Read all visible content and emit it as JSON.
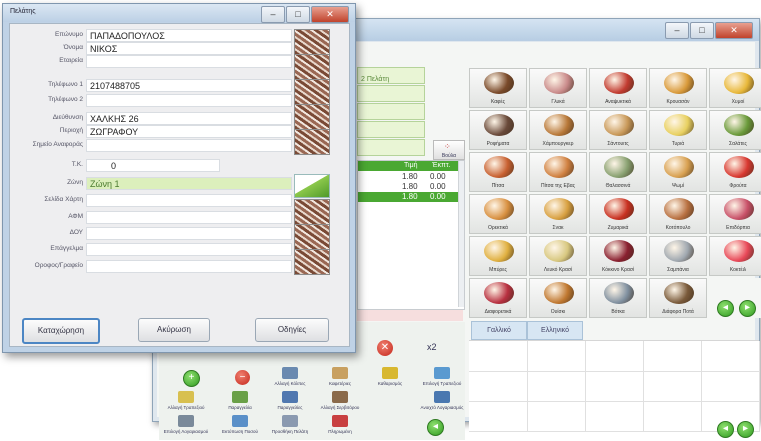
{
  "customer_dialog": {
    "title": "Πελάτης",
    "fields": [
      {
        "label": "Επώνυμο",
        "value": "ΠΑΠΑΔΟΠΟΥΛΟΣ"
      },
      {
        "label": "Όνομα",
        "value": "ΝΙΚΟΣ"
      },
      {
        "label": "Εταιρεία",
        "value": ""
      },
      {
        "label": "Τηλέφωνο 1",
        "value": "2107488705"
      },
      {
        "label": "Τηλέφωνο 2",
        "value": ""
      },
      {
        "label": "Διεύθυνση",
        "value": "ΧΑΛΚΗΣ 26"
      },
      {
        "label": "Περιοχή",
        "value": "ΖΩΓΡΑΦΟΥ"
      },
      {
        "label": "Σημείο Αναφοράς",
        "value": ""
      },
      {
        "label": "Τ.Κ.",
        "value": "0"
      },
      {
        "label": "Ζώνη",
        "value": "Ζώνη 1"
      },
      {
        "label": "Σελίδα Χάρτη",
        "value": ""
      },
      {
        "label": "ΑΦΜ",
        "value": ""
      },
      {
        "label": "ΔΟΥ",
        "value": ""
      },
      {
        "label": "Επάγγελμα",
        "value": ""
      },
      {
        "label": "Οροφος/Γραφείο",
        "value": ""
      }
    ],
    "buttons": {
      "register": "Καταχώρηση",
      "cancel": "Ακύρωση",
      "guide": "Οδηγίες"
    }
  },
  "pos": {
    "window_controls": {
      "minimize": "–",
      "maximize": "□",
      "close": "✕"
    },
    "table_field": "2 Πελάτη",
    "order_header": {
      "col1": "Τιμή",
      "col2": "Έκπτ."
    },
    "order_rows": [
      {
        "price": "1.80",
        "disc": "0.00"
      },
      {
        "price": "1.80",
        "disc": "0.00"
      },
      {
        "price": "1.80",
        "disc": "0.00"
      }
    ],
    "small_button_label": "Βούλα",
    "x2_label": "x2",
    "categories": [
      {
        "label": "Καφές",
        "color": "#7a4a2a"
      },
      {
        "label": "Γλυκά",
        "color": "#c98a8a"
      },
      {
        "label": "Αναψυκτικά",
        "color": "#c23b30"
      },
      {
        "label": "Κρουασάν",
        "color": "#d99a3a"
      },
      {
        "label": "Χυμοί",
        "color": "#e8b83a"
      },
      {
        "label": "Ροφήματα",
        "color": "#6a4a3a"
      },
      {
        "label": "Χάμπουργκερ",
        "color": "#b87838"
      },
      {
        "label": "Σάντουιτς",
        "color": "#c89858"
      },
      {
        "label": "Τυριά",
        "color": "#e8d060"
      },
      {
        "label": "Σαλάτες",
        "color": "#6a9a3a"
      },
      {
        "label": "Πίτσα",
        "color": "#c86030"
      },
      {
        "label": "Πίτσα της Εβας",
        "color": "#d08040"
      },
      {
        "label": "Θαλασσινά",
        "color": "#88a070"
      },
      {
        "label": "Ψωμί",
        "color": "#d8a050"
      },
      {
        "label": "Φρούτα",
        "color": "#d83830"
      },
      {
        "label": "Ορεκτικά",
        "color": "#d89040"
      },
      {
        "label": "Σνακ",
        "color": "#d8a040"
      },
      {
        "label": "Ζυμαρικά",
        "color": "#c83020"
      },
      {
        "label": "Κοτόπουλο",
        "color": "#b87040"
      },
      {
        "label": "Επιδόρπια",
        "color": "#c85068"
      },
      {
        "label": "Μπύρες",
        "color": "#e0b040"
      },
      {
        "label": "Λευκό Κρασί",
        "color": "#d8c880"
      },
      {
        "label": "Κόκκινο Κρασί",
        "color": "#8a2030"
      },
      {
        "label": "Σαμπάνια",
        "color": "#a0a8b0"
      },
      {
        "label": "Κοκτέιλ",
        "color": "#e84858"
      },
      {
        "label": "Διαφορετικά",
        "color": "#b83040"
      },
      {
        "label": "Ουίσκι",
        "color": "#c07830"
      },
      {
        "label": "Βότκα",
        "color": "#8090a0"
      },
      {
        "label": "Διάφορα Ποτά",
        "color": "#7a5a3a"
      },
      {
        "label": "",
        "color": ""
      }
    ],
    "lang_tabs": {
      "greek1": "Γαλλικό",
      "greek2": "Ελληνικό"
    },
    "tools": [
      {
        "label": "",
        "color": "#3aa02a"
      },
      {
        "label": "",
        "color": "#d03828"
      },
      {
        "label": "Αλλαγή Κόλπες",
        "color": "#6a8ab0"
      },
      {
        "label": "Καφετέριες",
        "color": "#c8a060"
      },
      {
        "label": "Καθαρισμός",
        "color": "#d8b830"
      },
      {
        "label": "Επιλογή Τραπεζιού",
        "color": "#5a9ad0"
      },
      {
        "label": "Αλλαγή Τραπεζιού",
        "color": "#d8c050"
      },
      {
        "label": "Παραγγελία",
        "color": "#6aa048"
      },
      {
        "label": "Παραγγελίες",
        "color": "#5078b0"
      },
      {
        "label": "Αλλαγή Σερβιτόρου",
        "color": "#8a6a4a"
      },
      {
        "label": "",
        "color": ""
      },
      {
        "label": "Ανοιχτό Λογαριασμός",
        "color": "#4a78b0"
      },
      {
        "label": "Επιλογή Λογαριασμού",
        "color": "#7a8a9a"
      },
      {
        "label": "Εκτύπωση Ποσού",
        "color": "#5a90c8"
      },
      {
        "label": "Προσθήκη Πελάτη",
        "color": "#8a9ab0"
      },
      {
        "label": "Πληρωμένη",
        "color": "#c84040"
      }
    ]
  }
}
